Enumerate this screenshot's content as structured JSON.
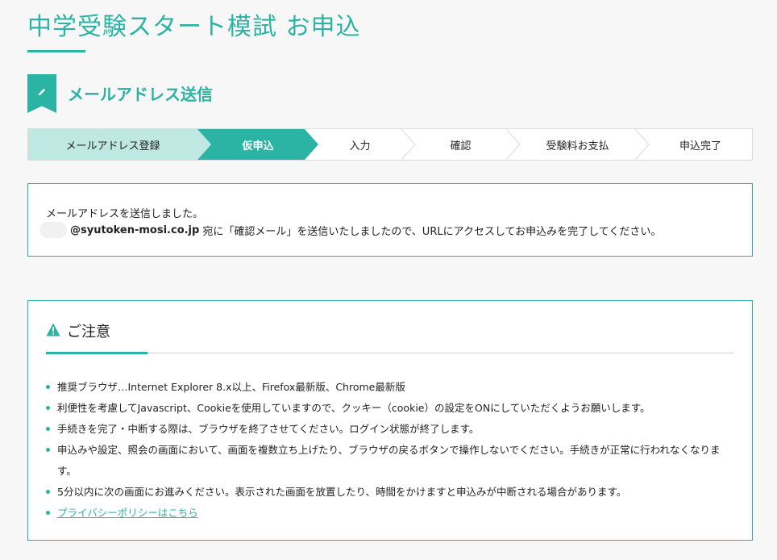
{
  "page": {
    "title": "中学受験スタート模試 お申込",
    "section_title": "メールアドレス送信",
    "section_icon": "pencil-icon"
  },
  "colors": {
    "accent": "#2bb3a3",
    "step_done_bg": "#bfe8e3",
    "step_current_bg": "#2bb3a3"
  },
  "steps": [
    {
      "label": "メールアドレス登録",
      "state": "done"
    },
    {
      "label": "仮申込",
      "state": "current"
    },
    {
      "label": "入力",
      "state": "todo"
    },
    {
      "label": "確認",
      "state": "todo"
    },
    {
      "label": "受験料お支払",
      "state": "todo"
    },
    {
      "label": "申込完了",
      "state": "todo"
    }
  ],
  "notice": {
    "line1": "メールアドレスを送信しました。",
    "email_domain": "@syutoken-mosi.co.jp",
    "line2_suffix": "宛に「確認メール」を送信いたしましたので、URLにアクセスしてお申込みを完了してください。"
  },
  "caution": {
    "icon": "warning-icon",
    "title": "ご注意",
    "items": [
      "推奨ブラウザ…Internet Explorer 8.x以上、Firefox最新版、Chrome最新版",
      "利便性を考慮してJavascript、Cookieを使用していますので、クッキー（cookie）の設定をONにしていただくようお願いします。",
      "手続きを完了・中断する際は、ブラウザを終了させてください。ログイン状態が終了します。",
      "申込みや設定、照会の画面において、画面を複数立ち上げたり、ブラウザの戻るボタンで操作しないでください。手続きが正常に行われなくなります。",
      "5分以内に次の画面にお進みください。表示された画面を放置したり、時間をかけますと申込みが中断される場合があります。"
    ],
    "privacy_link": "プライバシーポリシーはこちら"
  }
}
